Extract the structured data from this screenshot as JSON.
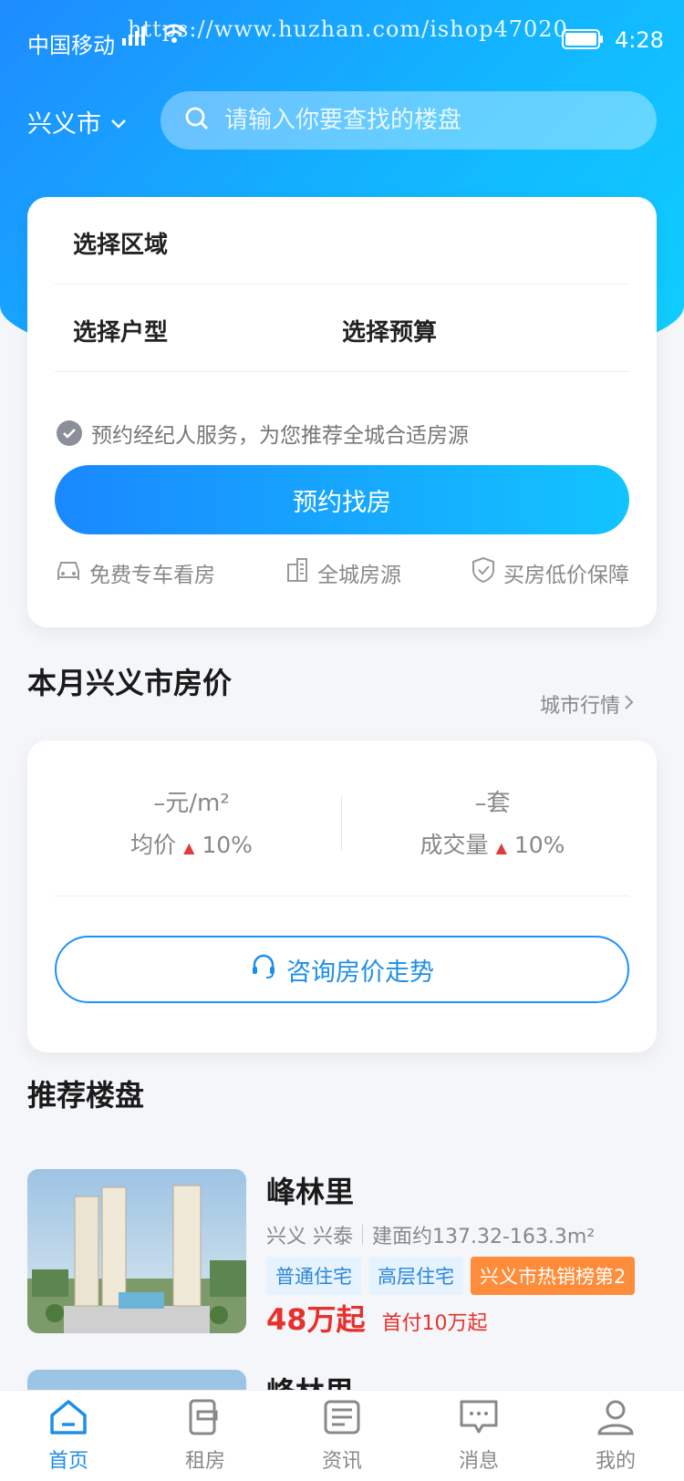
{
  "status_bar": {
    "carrier": "中国移动",
    "time": "4:28",
    "watermark": "https://www.huzhan.com/ishop47020"
  },
  "header": {
    "city": "兴义市",
    "search_placeholder": "请输入你要查找的楼盘"
  },
  "filter": {
    "region_label": "选择区域",
    "layout_label": "选择户型",
    "budget_label": "选择预算",
    "agent_note": "预约经纪人服务，为您推荐全城合适房源",
    "book_button": "预约找房",
    "features": [
      "免费专车看房",
      "全城房源",
      "买房低价保障"
    ]
  },
  "price_section": {
    "title": "本月兴义市房价",
    "market_link": "城市行情",
    "avg_value": "–元/m²",
    "avg_label": "均价",
    "avg_change": "10%",
    "deal_value": "–套",
    "deal_label": "成交量",
    "deal_change": "10%",
    "consult_button": "咨询房价走势"
  },
  "recommend": {
    "title": "推荐楼盘",
    "listings": [
      {
        "name": "峰林里",
        "area": "兴义 兴泰",
        "size": "建面约137.32-163.3m²",
        "tags": [
          "普通住宅",
          "高层住宅"
        ],
        "rank_tag": "兴义市热销榜第2",
        "price": "48万起",
        "down_payment": "首付10万起"
      },
      {
        "name": "峰林里"
      }
    ]
  },
  "tabs": [
    {
      "label": "首页",
      "icon": "home-icon"
    },
    {
      "label": "租房",
      "icon": "rent-icon"
    },
    {
      "label": "资讯",
      "icon": "news-icon"
    },
    {
      "label": "消息",
      "icon": "message-icon"
    },
    {
      "label": "我的",
      "icon": "profile-icon"
    }
  ],
  "colors": {
    "primary": "#1e8fe8",
    "price_red": "#e8302c",
    "rank_orange": "#ff8c3a"
  }
}
